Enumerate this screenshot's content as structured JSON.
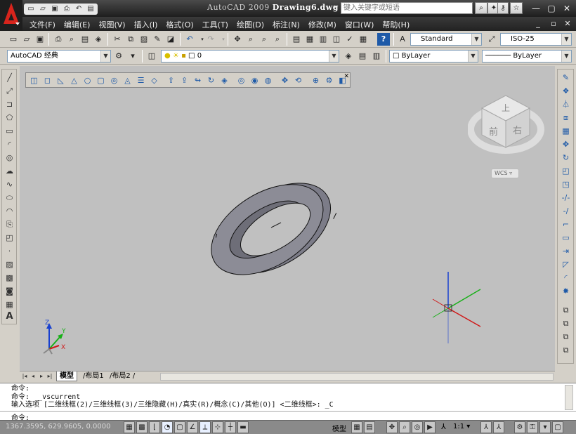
{
  "titlebar": {
    "app_name": "AutoCAD 2009",
    "document_name": "Drawing6.dwg",
    "search_placeholder": "键入关键字或短语",
    "qat_icons": [
      "new-icon",
      "open-icon",
      "save-icon",
      "print-icon",
      "undo-icon",
      "redo-icon"
    ],
    "window_controls": {
      "minimize": "—",
      "restore": "▢",
      "close": "✕"
    }
  },
  "menubar": {
    "items": [
      "文件(F)",
      "编辑(E)",
      "视图(V)",
      "插入(I)",
      "格式(O)",
      "工具(T)",
      "绘图(D)",
      "标注(N)",
      "修改(M)",
      "窗口(W)",
      "帮助(H)"
    ],
    "doc_controls": {
      "minimize": "_",
      "restore": "▫",
      "close": "✕"
    }
  },
  "toolbar1": {
    "text_style": "Standard",
    "dim_style": "ISO-25"
  },
  "toolbar2": {
    "workspace": "AutoCAD 经典",
    "layer": "0",
    "color": "ByLayer",
    "linetype": "ByLayer"
  },
  "layout_tabs": {
    "tabs": [
      "模型",
      "布局1",
      "布局2"
    ],
    "active": "模型"
  },
  "command": {
    "lines": [
      "命令:",
      "命令:  _vscurrent",
      "输入选项 [二维线框(2)/三维线框(3)/三维隐藏(H)/真实(R)/概念(C)/其他(O)] <二维线框>: _C"
    ],
    "prompt": "命令:"
  },
  "statusbar": {
    "coordinates": "1367.3595, 629.9605, 0.0000",
    "model_label": "模型",
    "annotation_scale": "1:1"
  },
  "viewcube": {
    "top_face": "上",
    "front_face": "前",
    "right_face": "右",
    "wcs_label": "WCS"
  },
  "ucs": {
    "x_label": "X",
    "y_label": "Y",
    "z_label": "Z"
  },
  "colors": {
    "axis_x": "#d01818",
    "axis_y": "#18b018",
    "axis_z": "#1840d0",
    "ring_fill": "#7c7c88",
    "canvas": "#c0c0c0"
  }
}
